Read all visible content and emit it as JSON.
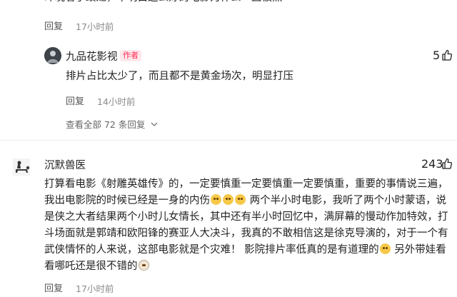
{
  "top_comment": {
    "text_tail": "昨晚看了蛟龙，不明白这么好的电影为什么一直被黑",
    "reply_label": "回复",
    "time": "17小时前"
  },
  "author_reply": {
    "username": "九品花影视",
    "author_badge": "作者",
    "likes": "5",
    "text": "排片占比太少了，而且都不是黄金场次，明显打压",
    "reply_label": "回复",
    "time": "14小时前",
    "view_all": "查看全部 72 条回复",
    "avatar_icon": "avatar-photo"
  },
  "main_comment": {
    "username": "沉默兽医",
    "likes": "243",
    "text_part1": "打算看电影《射雕英雄传》的，一定要慎重一定要慎重一定要慎重，重要的事情说三遍，我出电影院的时候已经是一身的内伤",
    "text_part2": " 两个半小时电影，我听了两个小时蒙语，说是侠之大者结果两个小时儿女情长，其中还有半小时回忆中，满屏幕的慢动作加特效，打斗场面就是郭靖和欧阳锋的赛亚人大决斗，我真的不敢相信这是徐克导演的，对于一个有武侠情怀的人来说，这部电影就是个灾难！ 影院排片率低真的是有道理的",
    "text_part3": " 另外带娃看看哪吒还是很不错的",
    "reply_label": "回复",
    "time": "17小时前",
    "avatar_icon": "avatar-dog-rider"
  },
  "colors": {
    "author_badge_text": "#fe2c55",
    "author_badge_bg": "#fde8ec",
    "meta_gray": "#8a8a8a",
    "divider": "#ededed"
  }
}
